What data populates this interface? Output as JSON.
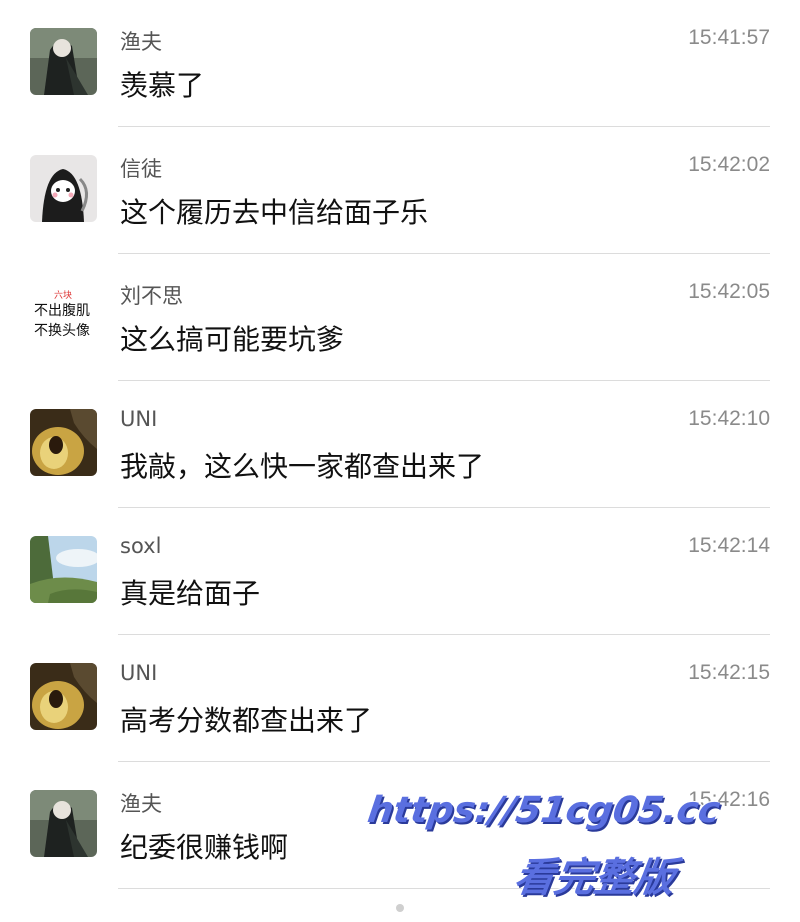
{
  "messages": [
    {
      "name": "渔夫",
      "time": "15:41:57",
      "text": "羡慕了",
      "avatar": "dark-anime-avatar"
    },
    {
      "name": "信徒",
      "time": "15:42:02",
      "text": "这个履历去中信给面子乐",
      "avatar": "hooded-reaper-avatar"
    },
    {
      "name": "刘不思",
      "time": "15:42:05",
      "text": "这么搞可能要坑爹",
      "avatar": "text-avatar",
      "avatar_text": {
        "top": "六块",
        "line1": "不出腹肌",
        "line2": "不换头像"
      }
    },
    {
      "name": "UNI",
      "time": "15:42:10",
      "text": "我敲，这么快一家都查出来了",
      "avatar": "cat-avatar"
    },
    {
      "name": "soxl",
      "time": "15:42:14",
      "text": "真是给面子",
      "avatar": "landscape-avatar"
    },
    {
      "name": "UNI",
      "time": "15:42:15",
      "text": "高考分数都查出来了",
      "avatar": "cat-avatar"
    },
    {
      "name": "渔夫",
      "time": "15:42:16",
      "text": "纪委很赚钱啊",
      "avatar": "dark-anime-avatar"
    }
  ],
  "watermark": {
    "url": "https://51cg05.cc",
    "label": "看完整版",
    "color": "#5a6fe0"
  }
}
